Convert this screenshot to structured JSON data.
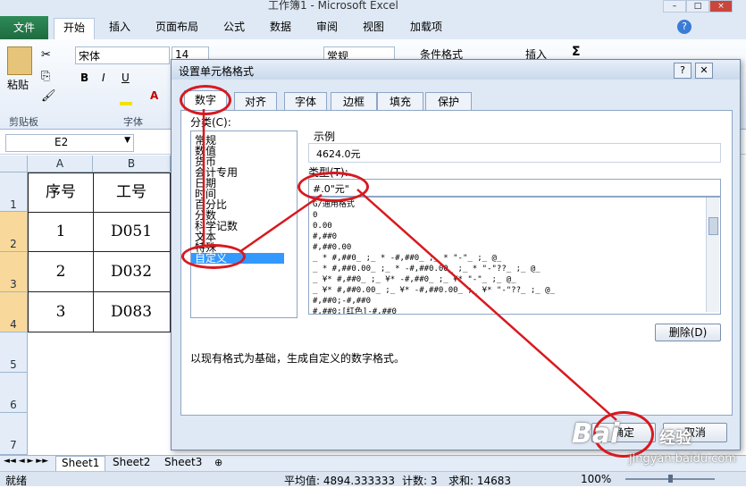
{
  "window": {
    "title": "工作簿1 - Microsoft Excel"
  },
  "ribbon": {
    "tabs": [
      "文件",
      "开始",
      "插入",
      "页面布局",
      "公式",
      "数据",
      "审阅",
      "视图",
      "加载项"
    ],
    "font_name": "宋体",
    "font_size": "14",
    "number_format": "常规",
    "paste_label": "粘贴",
    "clipboard_group": "剪贴板",
    "font_group": "字体",
    "bold": "B",
    "italic": "I",
    "underline": "U",
    "conditional_format": "条件格式",
    "insert_label": "插入",
    "sigma": "Σ",
    "font_color_glyph": "A"
  },
  "formula_bar": {
    "name_box": "E2"
  },
  "grid": {
    "columns": [
      "A",
      "B"
    ],
    "rows": [
      {
        "num": "1",
        "a": "序号",
        "b": "工号"
      },
      {
        "num": "2",
        "a": "1",
        "b": "D051"
      },
      {
        "num": "3",
        "a": "2",
        "b": "D032"
      },
      {
        "num": "4",
        "a": "3",
        "b": "D083"
      },
      {
        "num": "5",
        "a": "",
        "b": ""
      },
      {
        "num": "6",
        "a": "",
        "b": ""
      },
      {
        "num": "7",
        "a": "",
        "b": ""
      }
    ]
  },
  "sheets": [
    "Sheet1",
    "Sheet2",
    "Sheet3"
  ],
  "status": {
    "ready": "就绪",
    "average": "平均值: 4894.333333",
    "count": "计数: 3",
    "sum": "求和: 14683",
    "zoom": "100%"
  },
  "dialog": {
    "title": "设置单元格格式",
    "tabs": [
      "数字",
      "对齐",
      "字体",
      "边框",
      "填充",
      "保护"
    ],
    "category_label": "分类(C):",
    "categories": [
      "常规",
      "数值",
      "货币",
      "会计专用",
      "日期",
      "时间",
      "百分比",
      "分数",
      "科学记数",
      "文本",
      "特殊",
      "自定义"
    ],
    "sample_label": "示例",
    "sample_value": "4624.0元",
    "type_label": "类型(T):",
    "type_value": "#.0\"元\"",
    "formats": [
      "G/通用格式",
      "0",
      "0.00",
      "#,##0",
      "#,##0.00",
      "_ * #,##0_ ;_ * -#,##0_ ;_ * \"-\"_ ;_ @_",
      "_ * #,##0.00_ ;_ * -#,##0.00_ ;_ * \"-\"??_ ;_ @_",
      "_ ¥* #,##0_ ;_ ¥* -#,##0_ ;_ ¥* \"-\"_ ;_ @_",
      "_ ¥* #,##0.00_ ;_ ¥* -#,##0.00_ ;_ ¥* \"-\"??_ ;_ @_",
      "#,##0;-#,##0",
      "#,##0;[红色]-#,##0"
    ],
    "delete_button": "删除(D)",
    "description": "以现有格式为基础，生成自定义的数字格式。",
    "ok_button": "确定",
    "cancel_button": "取消"
  },
  "watermark": {
    "brand": "Bai",
    "brand2": "经验",
    "url": "jingyan.baidu.com"
  },
  "colors": {
    "annotation": "#d8191f",
    "selection": "#3399ff",
    "file_tab": "#217346"
  }
}
